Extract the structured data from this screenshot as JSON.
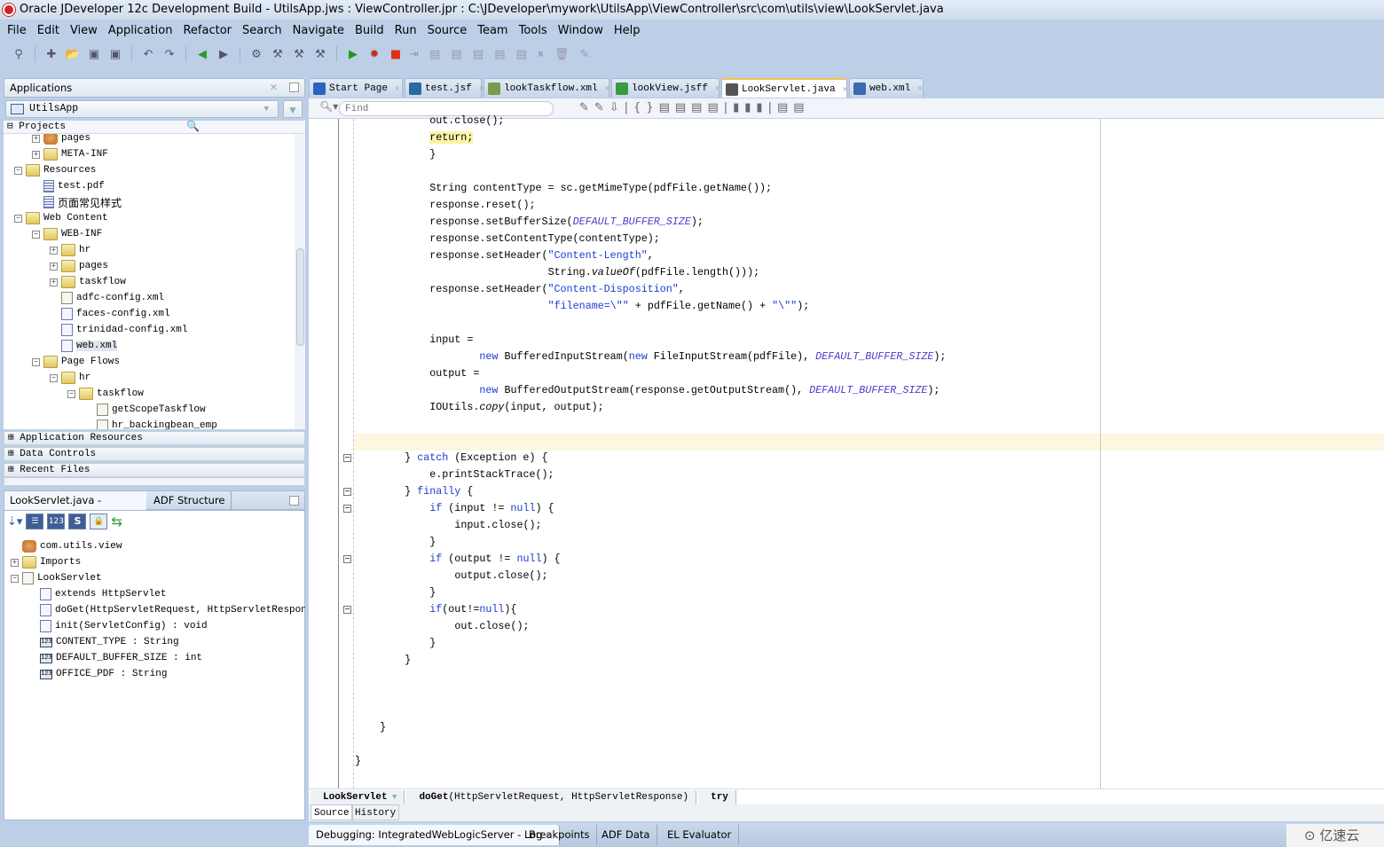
{
  "window": {
    "title": "Oracle JDeveloper 12c Development Build - UtilsApp.jws : ViewController.jpr : C:\\JDeveloper\\mywork\\UtilsApp\\ViewController\\src\\com\\utils\\view\\LookServlet.java"
  },
  "menu": [
    "File",
    "Edit",
    "View",
    "Application",
    "Refactor",
    "Search",
    "Navigate",
    "Build",
    "Run",
    "Source",
    "Team",
    "Tools",
    "Window",
    "Help"
  ],
  "toolbar_icons": [
    "binoculars-icon",
    "new-icon",
    "open-icon",
    "save-icon",
    "save-all-icon",
    "undo-icon",
    "redo-icon",
    "back-icon",
    "forward-icon",
    "deploy-icon",
    "make-icon",
    "rebuild-icon",
    "clean-icon",
    "run-icon",
    "debug-icon",
    "stop-icon",
    "step-icons"
  ],
  "applications": {
    "header": "Applications",
    "selected_app": "UtilsApp",
    "projects_label": "Projects",
    "tree": [
      {
        "d": 3,
        "icon": "pkg",
        "label": "pages",
        "exp": "+"
      },
      {
        "d": 3,
        "icon": "folder",
        "label": "META-INF",
        "exp": "+"
      },
      {
        "d": 2,
        "icon": "folder",
        "label": "Resources",
        "exp": "-"
      },
      {
        "d": 3,
        "icon": "file",
        "label": "test.pdf"
      },
      {
        "d": 3,
        "icon": "file",
        "label": "页面常见样式"
      },
      {
        "d": 2,
        "icon": "folder",
        "label": "Web Content",
        "exp": "-"
      },
      {
        "d": 3,
        "icon": "folder",
        "label": "WEB-INF",
        "exp": "-"
      },
      {
        "d": 4,
        "icon": "folder",
        "label": "hr",
        "exp": "+"
      },
      {
        "d": 4,
        "icon": "folder",
        "label": "pages",
        "exp": "+"
      },
      {
        "d": 4,
        "icon": "folder",
        "label": "taskflow",
        "exp": "+"
      },
      {
        "d": 4,
        "icon": "flow",
        "label": "adfc-config.xml"
      },
      {
        "d": 4,
        "icon": "xml",
        "label": "faces-config.xml"
      },
      {
        "d": 4,
        "icon": "xml",
        "label": "trinidad-config.xml"
      },
      {
        "d": 4,
        "icon": "xml",
        "label": "web.xml",
        "sel": true
      },
      {
        "d": 3,
        "icon": "folder",
        "label": "Page Flows",
        "exp": "-"
      },
      {
        "d": 4,
        "icon": "folder",
        "label": "hr",
        "exp": "-"
      },
      {
        "d": 5,
        "icon": "folder",
        "label": "taskflow",
        "exp": "-"
      },
      {
        "d": 6,
        "icon": "flow",
        "label": "getScopeTaskflow"
      },
      {
        "d": 6,
        "icon": "flow",
        "label": "hr_backingbean_emp"
      }
    ],
    "accordions": [
      "Application Resources",
      "Data Controls",
      "Recent Files"
    ]
  },
  "structure": {
    "tabs": [
      "LookServlet.java - Structure",
      "ADF Structure"
    ],
    "toolbar": [
      "sort-icon",
      "methods-icon",
      "fields-icon",
      "static-icon",
      "lock-icon",
      "sync-icon"
    ],
    "tree": [
      {
        "d": 0,
        "icon": "pkg",
        "label": "com.utils.view"
      },
      {
        "d": 0,
        "icon": "folder",
        "label": "Imports",
        "exp": "+"
      },
      {
        "d": 0,
        "icon": "class",
        "label": "LookServlet",
        "exp": "-"
      },
      {
        "d": 1,
        "icon": "extends",
        "label": "extends HttpServlet"
      },
      {
        "d": 1,
        "icon": "method",
        "label": "doGet(HttpServletRequest, HttpServletResponse)"
      },
      {
        "d": 1,
        "icon": "method",
        "label": "init(ServletConfig) : void"
      },
      {
        "d": 1,
        "icon": "num",
        "label": "CONTENT_TYPE : String"
      },
      {
        "d": 1,
        "icon": "num",
        "label": "DEFAULT_BUFFER_SIZE : int"
      },
      {
        "d": 1,
        "icon": "num",
        "label": "OFFICE_PDF : String"
      }
    ]
  },
  "editor": {
    "tabs": [
      {
        "label": "Start Page",
        "color": "#2e62c0"
      },
      {
        "label": "test.jsf",
        "color": "#2a6aa0"
      },
      {
        "label": "lookTaskflow.xml",
        "color": "#7a9a50"
      },
      {
        "label": "lookView.jsff",
        "color": "#3a9a40"
      },
      {
        "label": "LookServlet.java",
        "color": "#555",
        "active": true
      },
      {
        "label": "web.xml",
        "color": "#3a6ab0"
      }
    ],
    "find_placeholder": "Find",
    "code": [
      {
        "i": 12,
        "s": [
          [
            "out.close();",
            ""
          ]
        ]
      },
      {
        "i": 12,
        "s": [
          [
            "return;",
            "hl"
          ]
        ]
      },
      {
        "i": 12,
        "s": [
          [
            "}",
            ""
          ]
        ]
      },
      {
        "i": 0,
        "s": []
      },
      {
        "i": 12,
        "s": [
          [
            "String contentType = sc.getMimeType(pdfFile.getName());",
            ""
          ]
        ]
      },
      {
        "i": 12,
        "s": [
          [
            "response.reset();",
            ""
          ]
        ]
      },
      {
        "i": 12,
        "s": [
          [
            "response.setBufferSize(",
            ""
          ],
          [
            "DEFAULT_BUFFER_SIZE",
            "c"
          ],
          [
            ");",
            ""
          ]
        ]
      },
      {
        "i": 12,
        "s": [
          [
            "response.setContentType(contentType);",
            ""
          ]
        ]
      },
      {
        "i": 12,
        "s": [
          [
            "response.setHeader(",
            ""
          ],
          [
            "\"Content-Length\"",
            "s"
          ],
          [
            ",",
            ""
          ]
        ]
      },
      {
        "i": 31,
        "s": [
          [
            "String.",
            ""
          ],
          [
            "valueOf",
            "it"
          ],
          [
            "(pdfFile.length()));",
            ""
          ]
        ]
      },
      {
        "i": 12,
        "s": [
          [
            "response.setHeader(",
            ""
          ],
          [
            "\"Content-Disposition\"",
            "s"
          ],
          [
            ",",
            ""
          ]
        ]
      },
      {
        "i": 31,
        "s": [
          [
            "\"filename=\\\"\"",
            "s"
          ],
          [
            " + pdfFile.getName() + ",
            ""
          ],
          [
            "\"\\\"\"",
            "s"
          ],
          [
            ");",
            ""
          ]
        ]
      },
      {
        "i": 0,
        "s": []
      },
      {
        "i": 12,
        "s": [
          [
            "input =",
            ""
          ]
        ]
      },
      {
        "i": 20,
        "s": [
          [
            "new",
            "k"
          ],
          [
            " BufferedInputStream(",
            ""
          ],
          [
            "new",
            "k"
          ],
          [
            " FileInputStream(pdfFile), ",
            ""
          ],
          [
            "DEFAULT_BUFFER_SIZE",
            "c"
          ],
          [
            ");",
            ""
          ]
        ]
      },
      {
        "i": 12,
        "s": [
          [
            "output =",
            ""
          ]
        ]
      },
      {
        "i": 20,
        "s": [
          [
            "new",
            "k"
          ],
          [
            " BufferedOutputStream(response.getOutputStream(), ",
            ""
          ],
          [
            "DEFAULT_BUFFER_SIZE",
            "c"
          ],
          [
            ");",
            ""
          ]
        ]
      },
      {
        "i": 12,
        "s": [
          [
            "IOUtils.",
            ""
          ],
          [
            "copy",
            "it"
          ],
          [
            "(input, output);",
            ""
          ]
        ]
      },
      {
        "i": 0,
        "s": []
      },
      {
        "i": 0,
        "s": []
      },
      {
        "i": 8,
        "s": [
          [
            "} ",
            ""
          ],
          [
            "catch",
            "k"
          ],
          [
            " (Exception e) {",
            ""
          ]
        ],
        "fold": true
      },
      {
        "i": 12,
        "s": [
          [
            "e.printStackTrace();",
            ""
          ]
        ]
      },
      {
        "i": 8,
        "s": [
          [
            "} ",
            ""
          ],
          [
            "finally",
            "k"
          ],
          [
            " {",
            ""
          ]
        ],
        "fold": true
      },
      {
        "i": 12,
        "s": [
          [
            "if",
            "k"
          ],
          [
            " (input != ",
            ""
          ],
          [
            "null",
            "k"
          ],
          [
            ") {",
            ""
          ]
        ],
        "fold": true
      },
      {
        "i": 16,
        "s": [
          [
            "input.close();",
            ""
          ]
        ]
      },
      {
        "i": 12,
        "s": [
          [
            "}",
            ""
          ]
        ]
      },
      {
        "i": 12,
        "s": [
          [
            "if",
            "k"
          ],
          [
            " (output != ",
            ""
          ],
          [
            "null",
            "k"
          ],
          [
            ") {",
            ""
          ]
        ],
        "fold": true
      },
      {
        "i": 16,
        "s": [
          [
            "output.close();",
            ""
          ]
        ]
      },
      {
        "i": 12,
        "s": [
          [
            "}",
            ""
          ]
        ]
      },
      {
        "i": 12,
        "s": [
          [
            "if",
            "k"
          ],
          [
            "(out!=",
            ""
          ],
          [
            "null",
            "k"
          ],
          [
            "){",
            ""
          ]
        ],
        "fold": true
      },
      {
        "i": 16,
        "s": [
          [
            "out.close();",
            ""
          ]
        ]
      },
      {
        "i": 12,
        "s": [
          [
            "}",
            ""
          ]
        ]
      },
      {
        "i": 8,
        "s": [
          [
            "}",
            ""
          ]
        ]
      },
      {
        "i": 0,
        "s": []
      },
      {
        "i": 0,
        "s": []
      },
      {
        "i": 0,
        "s": []
      },
      {
        "i": 4,
        "s": [
          [
            "}",
            ""
          ]
        ]
      },
      {
        "i": 0,
        "s": []
      },
      {
        "i": 0,
        "s": [
          [
            "}",
            ""
          ]
        ]
      }
    ],
    "breadcrumb": [
      "LookServlet",
      "doGet(HttpServletRequest, HttpServletResponse)",
      "try"
    ],
    "view_tabs": [
      "Source",
      "History"
    ]
  },
  "bottom_tabs": [
    "Debugging: IntegratedWebLogicServer - Log",
    "Breakpoints",
    "ADF Data",
    "EL Evaluator"
  ],
  "watermark": "亿速云"
}
